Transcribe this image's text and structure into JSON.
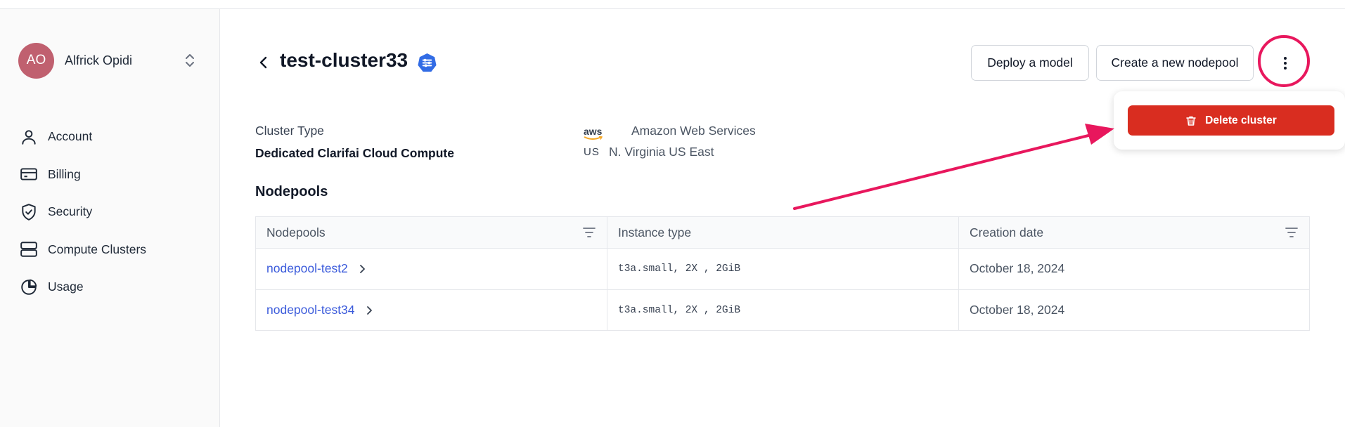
{
  "user": {
    "initials": "AO",
    "name": "Alfrick Opidi"
  },
  "sidebar": {
    "items": [
      {
        "label": "Account",
        "icon": "user-icon"
      },
      {
        "label": "Billing",
        "icon": "credit-card-icon"
      },
      {
        "label": "Security",
        "icon": "shield-icon"
      },
      {
        "label": "Compute Clusters",
        "icon": "server-icon"
      },
      {
        "label": "Usage",
        "icon": "pie-chart-icon"
      }
    ]
  },
  "header": {
    "title": "test-cluster33",
    "deploy_label": "Deploy a model",
    "create_label": "Create a new nodepool"
  },
  "menu": {
    "delete_label": "Delete cluster"
  },
  "info": {
    "cluster_type_label": "Cluster Type",
    "cluster_type_value": "Dedicated Clarifai Cloud Compute",
    "provider_logo": "aws",
    "provider": "Amazon Web Services",
    "region_code": "US",
    "region": "N. Virginia US East"
  },
  "nodepools": {
    "section_title": "Nodepools",
    "columns": [
      "Nodepools",
      "Instance type",
      "Creation date"
    ],
    "rows": [
      {
        "name": "nodepool-test2",
        "instance": "t3a.small, 2X , 2GiB",
        "date": "October 18, 2024"
      },
      {
        "name": "nodepool-test34",
        "instance": "t3a.small, 2X , 2GiB",
        "date": "October 18, 2024"
      }
    ]
  },
  "colors": {
    "accent": "#3b5bdb",
    "danger": "#d92d20",
    "highlight": "#e8175d",
    "avatar": "#c0606f"
  }
}
